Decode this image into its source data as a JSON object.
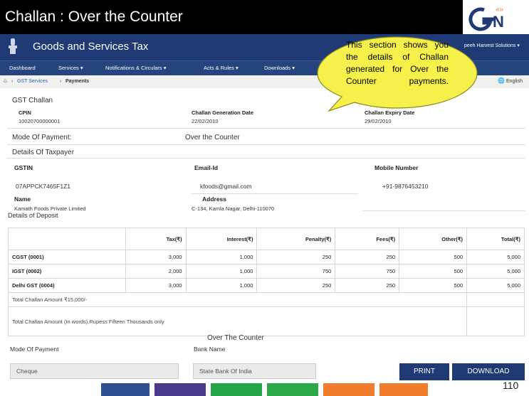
{
  "slide": {
    "title": "Challan : Over the Counter",
    "page_number": "110"
  },
  "header": {
    "app_name": "Goods and Services Tax",
    "user_name": "Harvest Solutions ▾",
    "user_prefix": "peeh"
  },
  "nav": [
    "Dashboard",
    "Services ▾",
    "Notifications & Circulars ▾",
    "Acts & Rules ▾",
    "Downloads ▾"
  ],
  "breadcrumb": {
    "home_icon": "home-icon",
    "services": "GST Services",
    "current": "Payments",
    "language": "English"
  },
  "challan": {
    "title": "GST Challan",
    "cpin_label": "CPIN",
    "cpin": "10020700000001",
    "gen_date_label": "Challan Generation Date",
    "gen_date": "22/02/2010",
    "exp_date_label": "Challan Expiry Date",
    "exp_date": "29/02/2010",
    "mode_label": "Mode Of Payment:",
    "mode_value": "Over the Counter"
  },
  "taxpayer": {
    "title": "Details Of Taxpayer",
    "gstin_label": "GSTIN",
    "gstin": "07APPCK7465F1Z1",
    "email_label": "Email-Id",
    "email": "kfoods@gmail.com",
    "mobile_label": "Mobile Number",
    "mobile": "+91-9876453210",
    "name_label": "Name",
    "name": "Kamath Foods Private Limited",
    "address_label": "Address",
    "address": "C-134, Kamla Nagar, Delhi-110070"
  },
  "deposit": {
    "title": "Details of Deposit",
    "headers": [
      "",
      "Tax(₹)",
      "Interest(₹)",
      "Penalty(₹)",
      "Fees(₹)",
      "Other(₹)",
      "Total(₹)"
    ],
    "rows": [
      [
        "CGST (0001)",
        "3,000",
        "1,000",
        "250",
        "250",
        "500",
        "5,000"
      ],
      [
        "IGST (0002)",
        "2,000",
        "1,000",
        "750",
        "750",
        "500",
        "5,000"
      ],
      [
        "Delhi GST (0004)",
        "3,000",
        "1,000",
        "250",
        "250",
        "500",
        "5,000"
      ]
    ],
    "total_amount": "Total Challan Amount ₹15,000/-",
    "total_words": "Total Challan Amount (In words).Rupess Fifteen Thousands only"
  },
  "otc": {
    "title": "Over The Counter",
    "mode_label": "Mode Of Payment",
    "bank_label": "Bank Name",
    "mode_value": "Cheque",
    "bank_value": "State Bank Of India",
    "print_label": "PRINT",
    "download_label": "DOWNLOAD"
  },
  "callout": {
    "text": "This section shows you the details of Challan generated for Over the Counter payments."
  },
  "logo": {
    "text": "GSN"
  },
  "colors": {
    "header": "#1f3a74",
    "callout": "#f5f04a",
    "bars": [
      "#2f4f93",
      "#4b3a8c",
      "#25a44a",
      "#2aa84a",
      "#f07d2b",
      "#f07d2b"
    ]
  }
}
